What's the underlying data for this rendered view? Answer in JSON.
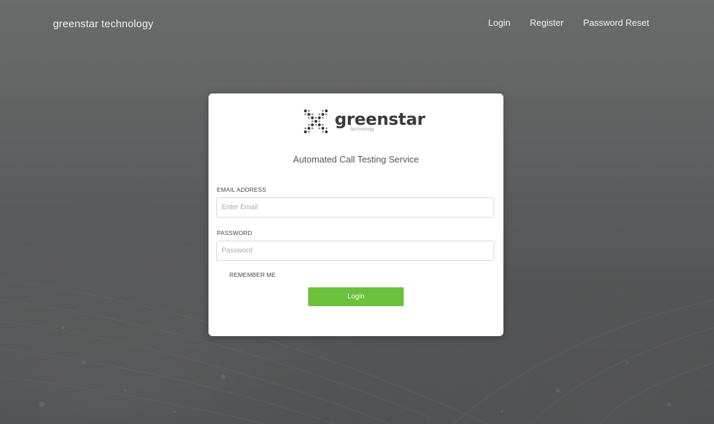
{
  "navbar": {
    "brand": "greenstar technology",
    "links": [
      "Login",
      "Register",
      "Password Reset"
    ]
  },
  "card": {
    "logo_word": "greenstar",
    "logo_sub": "technology",
    "service_title": "Automated Call Testing Service",
    "email_label": "EMAIL ADDRESS",
    "email_placeholder": "Enter Email",
    "email_value": "",
    "password_label": "PASSWORD",
    "password_placeholder": "Password",
    "password_value": "",
    "remember_label": "REMEMBER ME",
    "login_button": "Login"
  },
  "colors": {
    "accent_green": "#6cc13a",
    "background": "#5f6061",
    "card": "#ffffff"
  }
}
